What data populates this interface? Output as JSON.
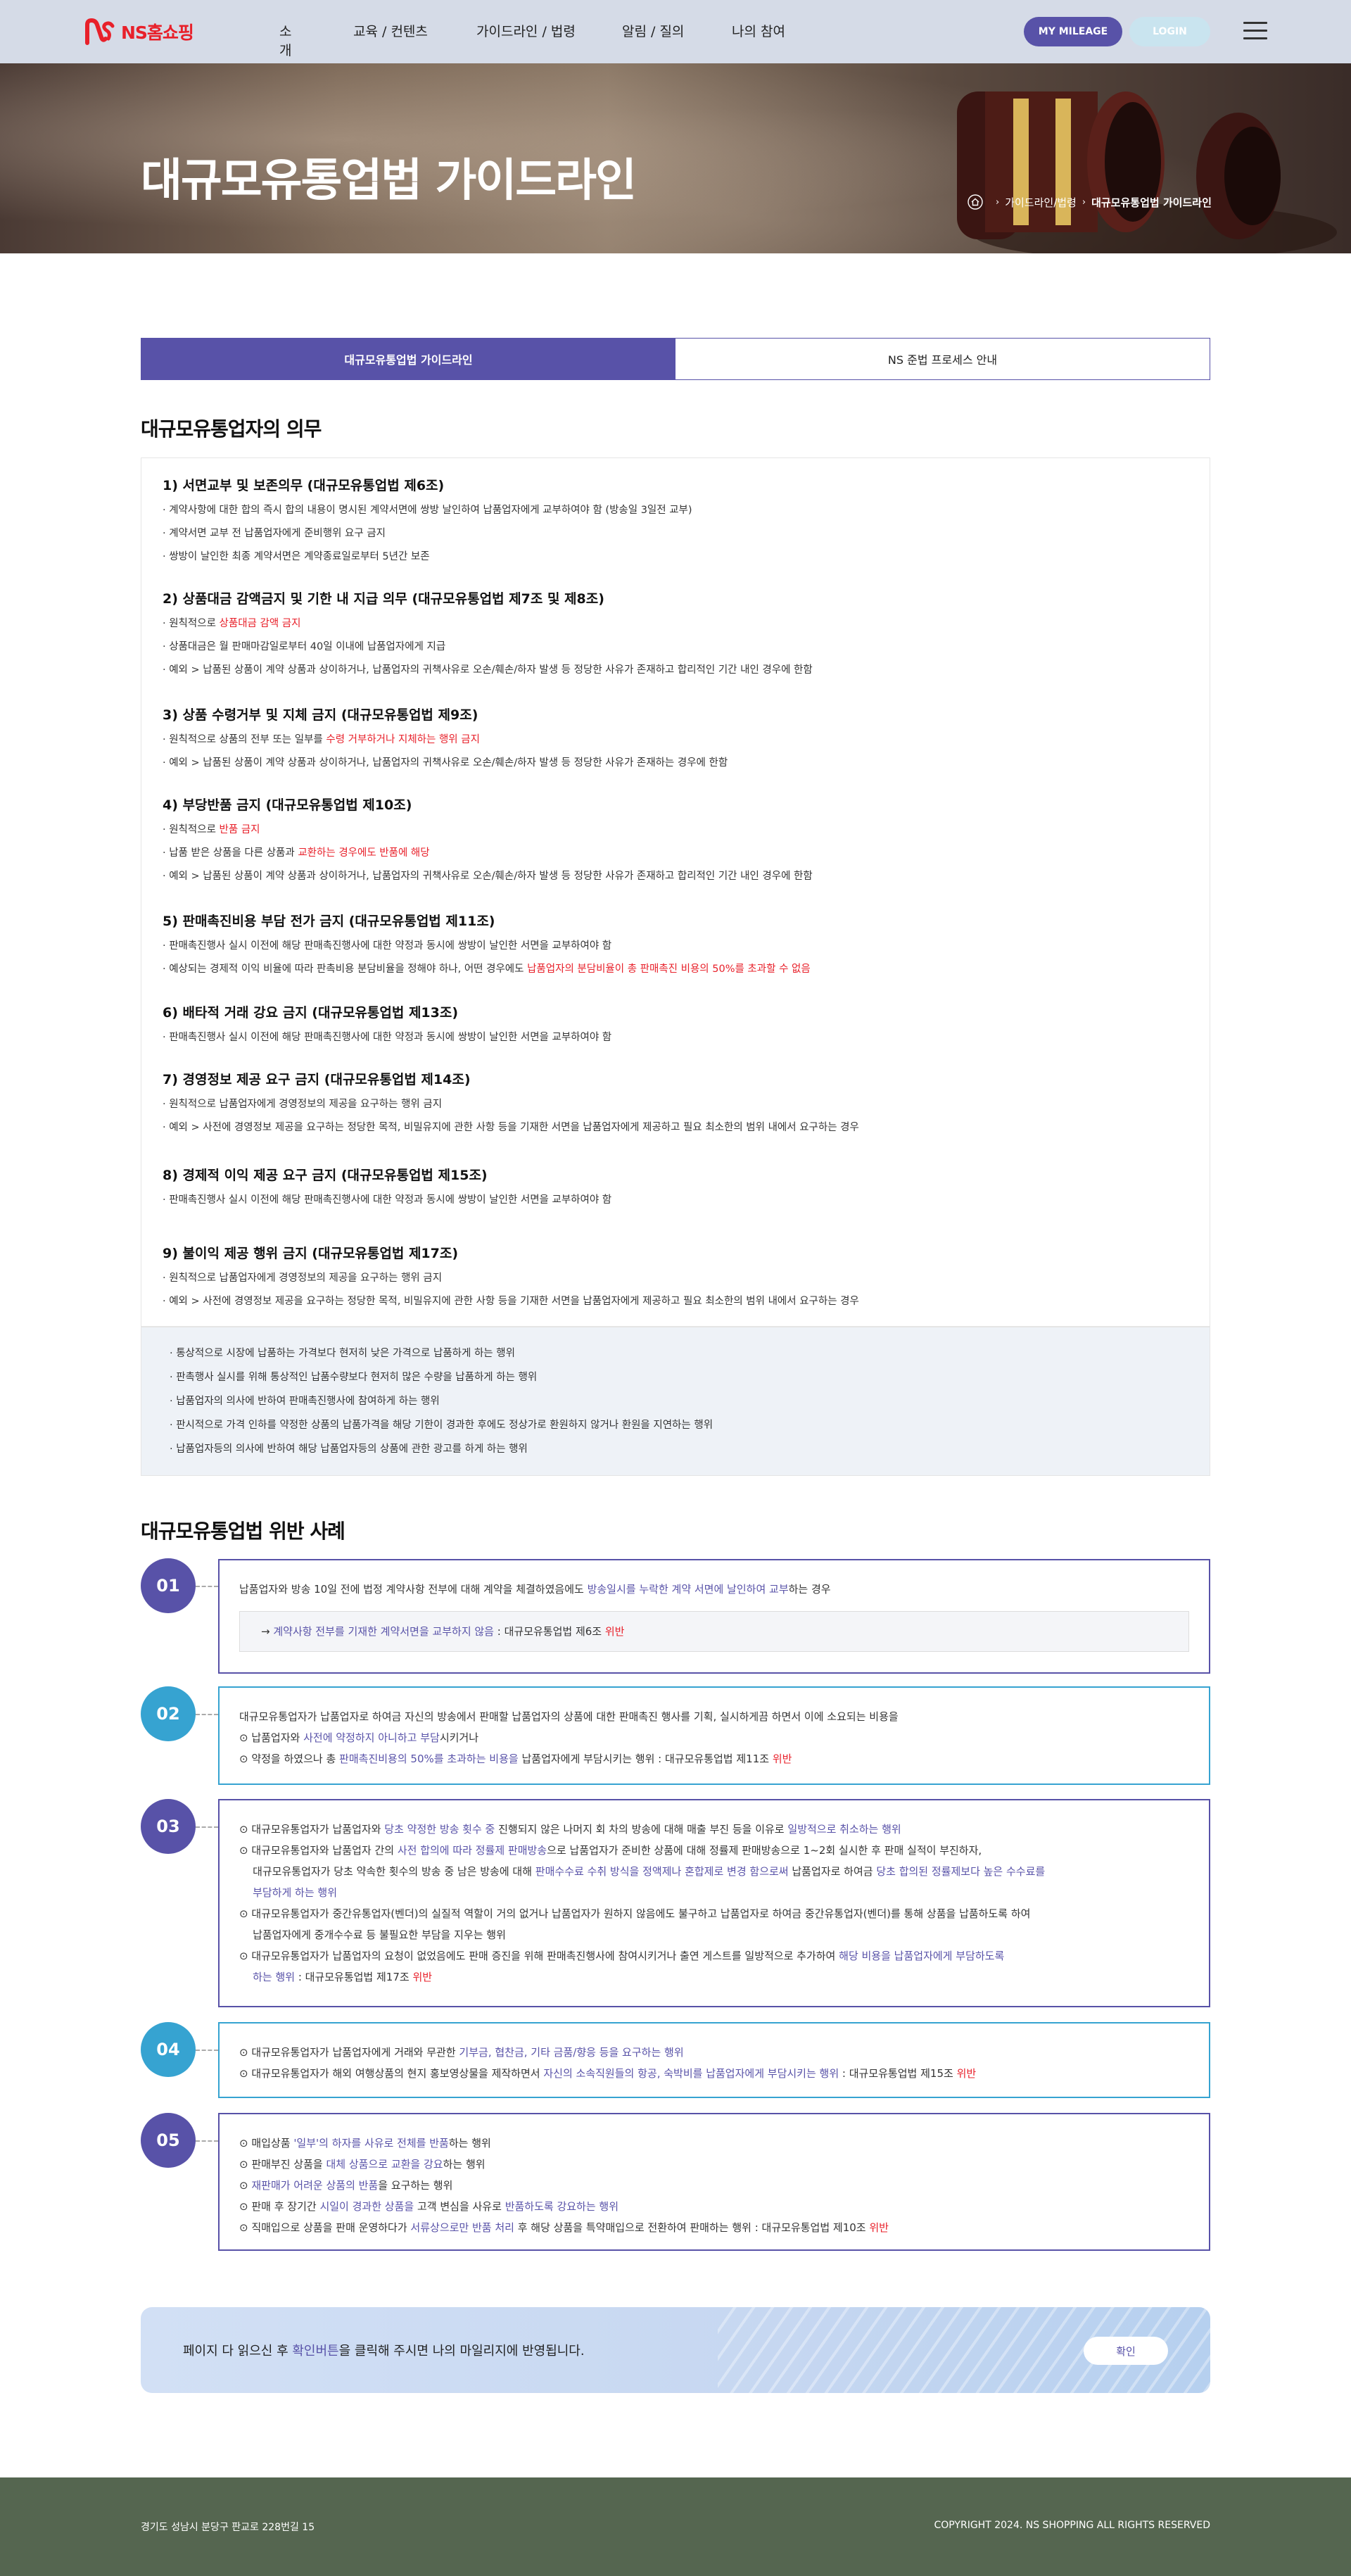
{
  "header": {
    "logo_text": "NS홈쇼핑",
    "nav": [
      "소개",
      "교육 / 컨텐츠",
      "가이드라인 / 법령",
      "알림 / 질의",
      "나의 참여"
    ],
    "mileage_label": "MY MILEAGE",
    "login_label": "LOGIN"
  },
  "hero": {
    "title": "대규모유통업법 가이드라인",
    "breadcrumb": [
      "가이드라인/법령",
      "대규모유통업법 가이드라인"
    ]
  },
  "tabs": [
    "대규모유통업법 가이드라인",
    "NS 준법 프로세스 안내"
  ],
  "duties": {
    "title": "대규모유통업자의 의무",
    "items": [
      {
        "title": "1) 서면교부 및 보존의무 (대규모유통업법 제6조)",
        "lines": [
          [
            [
              "· 계약사항에 대한 합의 즉시 합의 내용이 명시된 계약서면에 쌍방 날인하여 납품업자에게 교부하여야 함 (방송일 3일전 교부)",
              ""
            ]
          ],
          [
            [
              "· 계약서면 교부 전 납품업자에게 준비행위 요구 금지",
              ""
            ]
          ],
          [
            [
              "· 쌍방이 날인한 최종 계약서면은 계약종료일로부터 5년간 보존",
              ""
            ]
          ]
        ]
      },
      {
        "title": "2) 상품대금 감액금지 및 기한 내 지급 의무 (대규모유통업법 제7조 및 제8조)",
        "lines": [
          [
            [
              "· 원칙적으로 ",
              ""
            ],
            [
              "상품대금 감액 금지",
              "r"
            ]
          ],
          [
            [
              "· 상품대금은 월 판매마감일로부터 40일 이내에 납품업자에게 지급",
              ""
            ]
          ],
          [
            [
              "· 예외 > 납품된 상품이 계약 상품과 상이하거나, 납품업자의 귀책사유로 오손/훼손/하자 발생 등 정당한 사유가 존재하고 합리적인 기간 내인 경우에 한함",
              ""
            ]
          ]
        ]
      },
      {
        "title": "3) 상품 수령거부 및 지체 금지 (대규모유통업법 제9조)",
        "lines": [
          [
            [
              "· 원칙적으로 상품의 전부 또는 일부를 ",
              ""
            ],
            [
              "수령 거부하거나 지체하는 행위 금지",
              "r"
            ]
          ],
          [
            [
              "· 예외 > 납품된 상품이 계약 상품과 상이하거나, 납품업자의 귀책사유로 오손/훼손/하자 발생 등 정당한 사유가 존재하는 경우에 한함",
              ""
            ]
          ]
        ]
      },
      {
        "title": "4) 부당반품 금지 (대규모유통업법 제10조)",
        "lines": [
          [
            [
              "· 원칙적으로 ",
              ""
            ],
            [
              "반품 금지",
              "r"
            ]
          ],
          [
            [
              "· 납품 받은 상품을 다른 상품과 ",
              ""
            ],
            [
              "교환하는 경우에도 반품에 해당",
              "r"
            ]
          ],
          [
            [
              "· 예외 > 납품된 상품이 계약 상품과 상이하거나, 납품업자의 귀책사유로 오손/훼손/하자 발생 등 정당한 사유가 존재하고 합리적인 기간 내인 경우에 한함",
              ""
            ]
          ]
        ]
      },
      {
        "title": "5) 판매촉진비용 부담 전가 금지 (대규모유통업법 제11조)",
        "lines": [
          [
            [
              "· 판매촉진행사 실시 이전에 해당 판매촉진행사에 대한 약정과 동시에 쌍방이 날인한 서면을 교부하여야 함",
              ""
            ]
          ],
          [
            [
              "· 예상되는 경제적 이익 비율에 따라 판촉비용 분담비율을 정해야 하나, 어떤 경우에도 ",
              ""
            ],
            [
              "납품업자의 분담비율이 총 판매촉진 비용의 50%를 초과할 수 없음",
              "r"
            ]
          ]
        ]
      },
      {
        "title": "6) 배타적 거래 강요 금지 (대규모유통업법 제13조)",
        "lines": [
          [
            [
              "· 판매촉진행사 실시 이전에 해당 판매촉진행사에 대한 약정과 동시에 쌍방이 날인한 서면을 교부하여야 함",
              ""
            ]
          ]
        ]
      },
      {
        "title": "7) 경영정보 제공 요구 금지 (대규모유통업법 제14조)",
        "lines": [
          [
            [
              "· 원칙적으로 납품업자에게 경영정보의 제공을 요구하는 행위 금지",
              ""
            ]
          ],
          [
            [
              "· 예외 > 사전에 경영정보 제공을 요구하는 정당한 목적, 비밀유지에 관한 사항 등을 기재한 서면을 납품업자에게 제공하고 필요 최소한의 범위 내에서 요구하는 경우",
              ""
            ]
          ]
        ]
      },
      {
        "title": "8) 경제적 이익 제공 요구 금지 (대규모유통업법 제15조)",
        "lines": [
          [
            [
              "· 판매촉진행사 실시 이전에 해당 판매촉진행사에 대한 약정과 동시에 쌍방이 날인한 서면을 교부하여야 함",
              ""
            ]
          ]
        ]
      },
      {
        "title": "9) 불이익 제공 행위 금지 (대규모유통업법 제17조)",
        "lines": [
          [
            [
              "· 원칙적으로 납품업자에게 경영정보의 제공을 요구하는 행위 금지",
              ""
            ]
          ],
          [
            [
              "· 예외 > 사전에 경영정보 제공을 요구하는 정당한 목적, 비밀유지에 관한 사항 등을 기재한 서면을 납품업자에게 제공하고 필요 최소한의 범위 내에서 요구하는 경우",
              ""
            ]
          ]
        ]
      }
    ],
    "notes": [
      "· 통상적으로 시장에 납품하는 가격보다 현저히 낮은 가격으로 납품하게 하는 행위",
      "· 판촉행사 실시를 위해 통상적인 납품수량보다 현저히 많은 수량을 납품하게 하는 행위",
      "· 납품업자의 의사에 반하여 판매촉진행사에 참여하게 하는 행위",
      "· 판시적으로 가격 인하를 약정한 상품의 납품가격을 해당 기한이 경과한 후에도 정상가로 환원하지 않거나 환원을 지연하는 행위",
      "· 납품업자등의 의사에 반하여 해당 납품업자등의 상품에 관한 광고를 하게 하는 행위"
    ]
  },
  "cases": {
    "title": "대규모유통업법 위반 사례",
    "items": [
      {
        "num": "01",
        "color": "#5852a8",
        "lines": [
          [
            [
              "납품업자와 방송 10일 전에 법정 계약사항 전부에 대해 계약을 체결하였음에도 ",
              ""
            ],
            [
              "방송일시를 누락한 계약 서면에 날인하여 교부",
              "p"
            ],
            [
              "하는 경우",
              ""
            ]
          ]
        ],
        "sub": [
          [
            "→ ",
            ""
          ],
          [
            "계약사항 전부를 기재한 계약서면을 교부하지 않음",
            "p"
          ],
          [
            " : 대규모유통업법 제6조 ",
            ""
          ],
          [
            "위반",
            "r"
          ]
        ]
      },
      {
        "num": "02",
        "color": "#36a3d1",
        "lines": [
          [
            [
              "대규모유통업자가 납품업자로 하여금 자신의 방송에서 판매할 납품업자의 상품에 대한 판매촉진 행사를 기획, 실시하게끔 하면서 이에 소요되는 비용을",
              ""
            ]
          ],
          [
            [
              "⊙ 납품업자와 ",
              ""
            ],
            [
              "사전에 약정하지 아니하고 부담",
              "p"
            ],
            [
              "시키거나",
              ""
            ]
          ],
          [
            [
              "⊙ 약정을 하였으나 총 ",
              ""
            ],
            [
              "판매촉진비용의 50%를 초과하는 비용을",
              "p"
            ],
            [
              " 납품업자에게 부담시키는 행위 : 대규모유통업법 제11조 ",
              ""
            ],
            [
              "위반",
              "r"
            ]
          ]
        ]
      },
      {
        "num": "03",
        "color": "#5852a8",
        "lines": [
          [
            [
              "⊙ 대규모유통업자가 납품업자와 ",
              ""
            ],
            [
              "당초 약정한 방송 횟수 중",
              "p"
            ],
            [
              " 진행되지 않은 나머지 회 차의 방송에 대해 매출 부진 등을 이유로 ",
              ""
            ],
            [
              "일방적으로 취소하는 행위",
              "p"
            ]
          ],
          [
            [
              "⊙ 대규모유통업자와 납품업자 간의 ",
              ""
            ],
            [
              "사전 합의에 따라 정률제 판매방송",
              "p"
            ],
            [
              "으로 납품업자가 준비한 상품에 대해 정률제 판매방송으로 1~2회 실시한 후 판매 실적이 부진하자,",
              ""
            ]
          ],
          [
            [
              "    대규모유통업자가 당초 약속한 횟수의 방송 중 남은 방송에 대해 ",
              ""
            ],
            [
              "판매수수료 수취 방식을 정액제나 혼합제로 변경 함으로써",
              "p"
            ],
            [
              " 납품업자로 하여금 ",
              ""
            ],
            [
              "당초 합의된 정률제보다 높은 수수료를",
              "p"
            ]
          ],
          [
            [
              "    ",
              ""
            ],
            [
              "부담하게 하는 행위",
              "p"
            ]
          ],
          [
            [
              "⊙ 대규모유통업자가 중간유통업자(벤더)의 실질적 역할이 거의 없거나 납품업자가 원하지 않음에도 불구하고 납품업자로 하여금 중간유통업자(벤더)를 통해 상품을 납품하도록 하여",
              ""
            ]
          ],
          [
            [
              "    납품업자에게 중개수수료 등 불필요한 부담을 지우는 행위",
              ""
            ]
          ],
          [
            [
              "⊙ 대규모유통업자가 납품업자의 요청이 없었음에도 판매 증진을 위해 판매촉진행사에 참여시키거나 출연 게스트를 일방적으로 추가하여 ",
              ""
            ],
            [
              "해당 비용을 납품업자에게 부담하도록",
              "p"
            ]
          ],
          [
            [
              "    ",
              ""
            ],
            [
              "하는 행위",
              "p"
            ],
            [
              " : 대규모유통업법 제17조 ",
              ""
            ],
            [
              "위반",
              "r"
            ]
          ]
        ]
      },
      {
        "num": "04",
        "color": "#36a3d1",
        "lines": [
          [
            [
              "⊙ 대규모유통업자가 납품업자에게 거래와 무관한 ",
              ""
            ],
            [
              "기부금, 협찬금, 기타 금품/향응 등을 요구하는 행위",
              "p"
            ]
          ],
          [
            [
              "⊙ 대규모유통업자가 해외 여행상품의 현지 홍보영상물을 제작하면서 ",
              ""
            ],
            [
              "자신의 소속직원들의 항공, 숙박비를 납품업자에게 부담시키는 행위",
              "p"
            ],
            [
              " : 대규모유통업법 제15조 ",
              ""
            ],
            [
              "위반",
              "r"
            ]
          ]
        ]
      },
      {
        "num": "05",
        "color": "#5852a8",
        "lines": [
          [
            [
              "⊙ 매입상품 ",
              ""
            ],
            [
              "'일부'의 하자를 사유로 전체를 반품",
              "p"
            ],
            [
              "하는 행위",
              ""
            ]
          ],
          [
            [
              "⊙ 판매부진 상품을 ",
              ""
            ],
            [
              "대체 상품으로 교환을 강요",
              "p"
            ],
            [
              "하는 행위",
              ""
            ]
          ],
          [
            [
              "⊙ ",
              ""
            ],
            [
              "재판매가 어려운 상품의 반품",
              "p"
            ],
            [
              "을 요구하는 행위",
              ""
            ]
          ],
          [
            [
              "⊙ 판매 후 장기간 ",
              ""
            ],
            [
              "시일이 경과한 상품을",
              "p"
            ],
            [
              " 고객 변심을 사유로 ",
              ""
            ],
            [
              "반품하도록 강요하는 행위",
              "p"
            ]
          ],
          [
            [
              "⊙ 직매입으로 상품을 판매 운영하다가 ",
              ""
            ],
            [
              "서류상으로만 반품 처리",
              "p"
            ],
            [
              " 후 해당 상품을 특약매입으로 전환하여 판매하는 행위 : 대규모유통업법 제10조 ",
              ""
            ],
            [
              "위반",
              "r"
            ]
          ]
        ]
      }
    ]
  },
  "confirm": {
    "text_parts": [
      [
        "페이지 다 읽으신 후 ",
        ""
      ],
      [
        "확인버튼",
        "p"
      ],
      [
        "을 클릭해 주시면 나의 마일리지에 반영됩니다.",
        ""
      ]
    ],
    "button_label": "확인"
  },
  "footer": {
    "address": "경기도 성남시 분당구 판교로 228번길 15",
    "copyright": "COPYRIGHT 2024. NS SHOPPING ALL RIGHTS RESERVED"
  },
  "colors": {
    "brand_purple": "#5852a8",
    "accent_blue": "#36a3d1",
    "violation_red": "#e8202a",
    "footer_green": "#556650"
  }
}
